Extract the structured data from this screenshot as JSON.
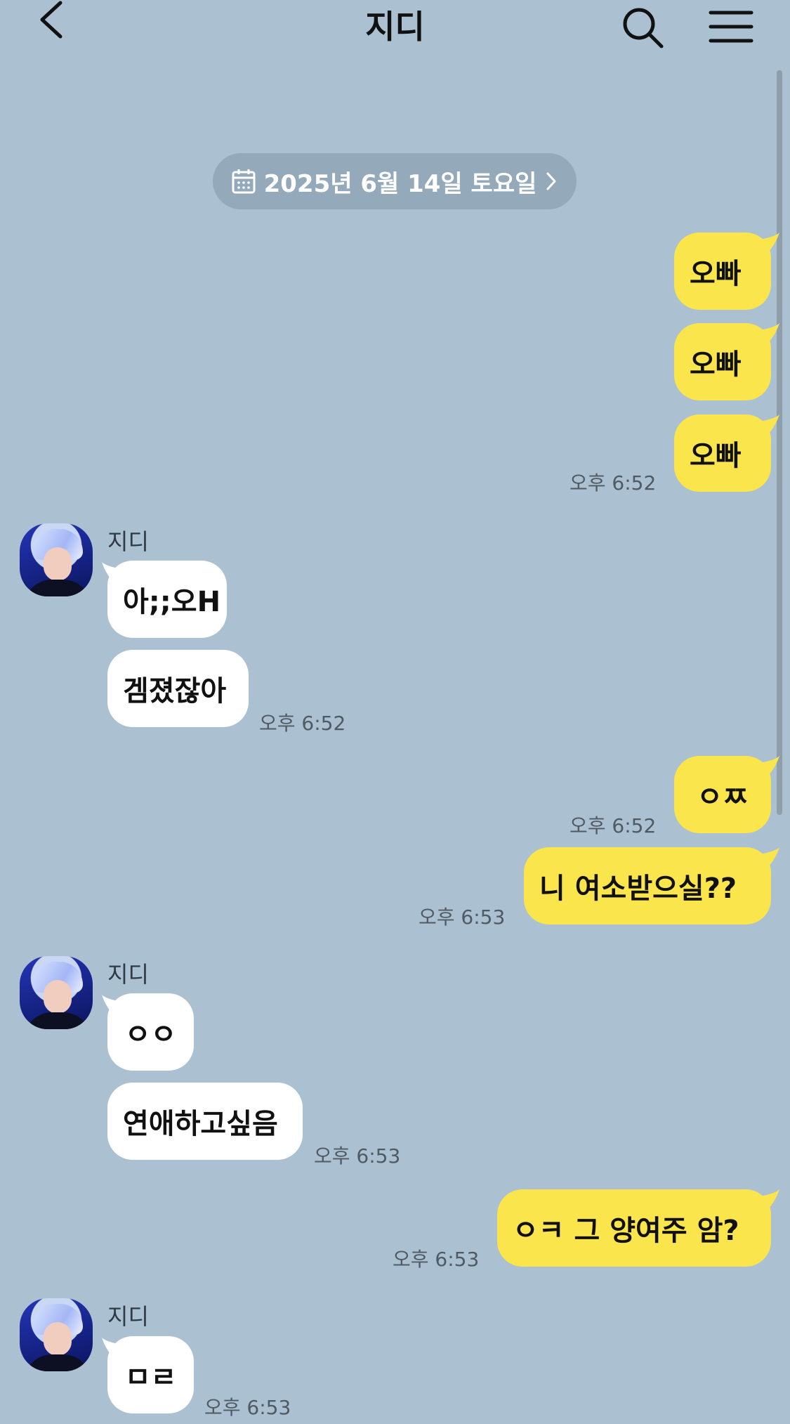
{
  "header": {
    "title": "지디",
    "back_icon": "chevron-left-icon",
    "search_icon": "search-icon",
    "menu_icon": "hamburger-menu-icon"
  },
  "date_divider": {
    "label": "2025년 6월 14일 토요일"
  },
  "colors": {
    "background": "#abc1d1",
    "my_bubble": "#fbe54d",
    "their_bubble": "#ffffff"
  },
  "messages": [
    {
      "from": "me",
      "text": "오빠"
    },
    {
      "from": "me",
      "text": "오빠"
    },
    {
      "from": "me",
      "text": "오빠",
      "time": "오후 6:52"
    },
    {
      "from": "them",
      "sender": "지디",
      "text": "아;;오H"
    },
    {
      "from": "them",
      "text": "겜졌잖아",
      "time": "오후 6:52"
    },
    {
      "from": "me",
      "text": "ㅇㅉ",
      "time": "오후 6:52"
    },
    {
      "from": "me",
      "text": "니 여소받으실??",
      "time": "오후 6:53"
    },
    {
      "from": "them",
      "sender": "지디",
      "text": "ㅇㅇ"
    },
    {
      "from": "them",
      "text": "연애하고싶음",
      "time": "오후 6:53"
    },
    {
      "from": "me",
      "text": "ㅇㅋ 그 양여주 암?",
      "time": "오후 6:53"
    },
    {
      "from": "them",
      "sender": "지디",
      "text": "ㅁㄹ",
      "time": "오후 6:53"
    }
  ]
}
